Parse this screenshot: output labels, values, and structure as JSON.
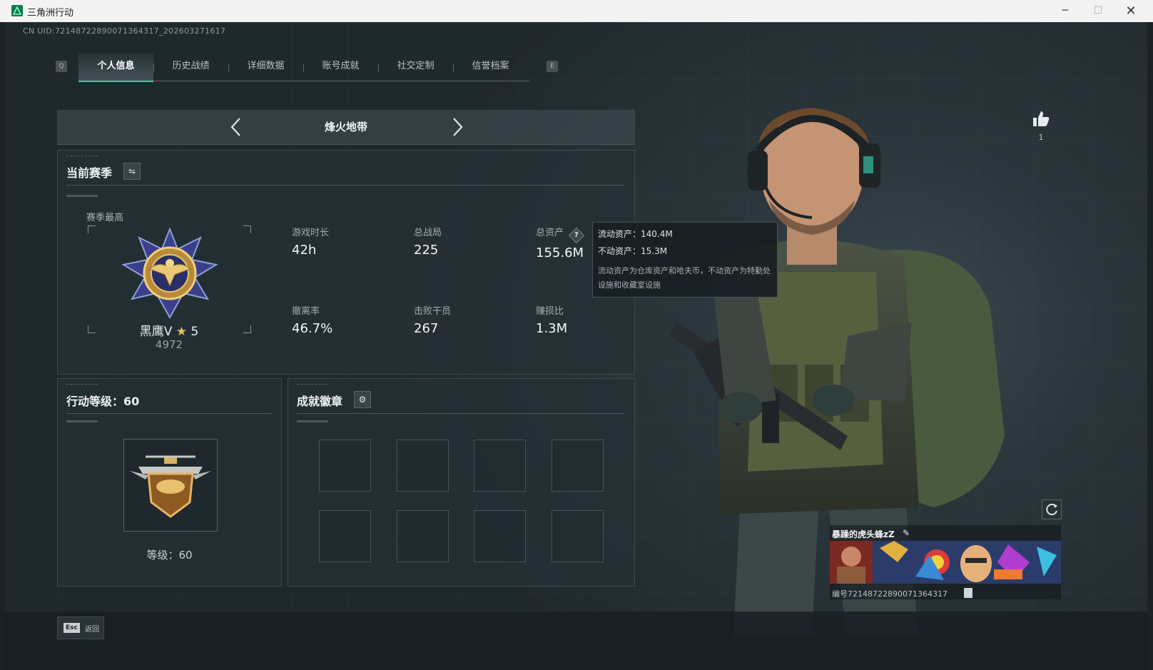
{
  "window": {
    "title": "三角洲行动",
    "minimize": "─",
    "maximize": "☐",
    "close": "✕"
  },
  "header": {
    "uid": "CN UID:7214872289007136431​7_202603271617"
  },
  "tabs": {
    "prev_key": "Q",
    "next_key": "E",
    "items": [
      {
        "label": "个人信息",
        "active": true
      },
      {
        "label": "历史战绩"
      },
      {
        "label": "详细数据"
      },
      {
        "label": "账号成就"
      },
      {
        "label": "社交定制"
      },
      {
        "label": "信誉档案"
      }
    ]
  },
  "mode": {
    "name": "烽火地带"
  },
  "season": {
    "title": "当前赛季",
    "switch_icon": "swap-icon",
    "best_label": "赛季最高",
    "rank_name": "黑鹰V",
    "rank_star": "★",
    "rank_level": "5",
    "rank_score": "4972",
    "stats": {
      "playtime": {
        "label": "游戏时长",
        "value": "42h"
      },
      "matches": {
        "label": "总战局",
        "value": "225"
      },
      "assets": {
        "label": "总资产",
        "value": "155.6M",
        "help": "?"
      },
      "extract_rate": {
        "label": "撤离率",
        "value": "46.7%"
      },
      "kills": {
        "label": "击败干员",
        "value": "267"
      },
      "profit_ratio": {
        "label": "赚损比",
        "value": "1.3M"
      }
    }
  },
  "tooltip": {
    "liquid": "流动资产：140.4M",
    "fixed": "不动资产：15.3M",
    "note": "流动资产为仓库资产和哈夫币，不动资产为特勤处设施和收藏室设施"
  },
  "level_panel": {
    "title": "行动等级：60",
    "level_text": "等级：60"
  },
  "achievements": {
    "title": "成就徽章",
    "settings_icon": "gear-icon",
    "slots": 8
  },
  "profile": {
    "likes": "1",
    "nickname": "暴躁的虎头蜂zZ",
    "id_number": "编号7214872289007136431​7"
  },
  "footer": {
    "esc_key": "Esc",
    "esc_label": "返回"
  },
  "colors": {
    "accent": "#2dd4a0",
    "background": "#222b30",
    "panel": "#263036"
  }
}
